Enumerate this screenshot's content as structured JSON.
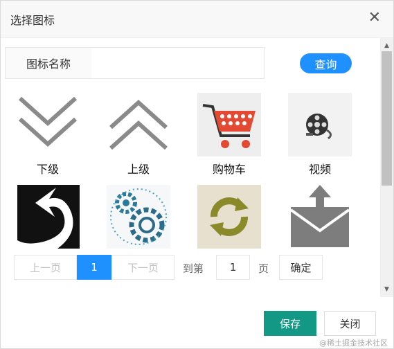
{
  "dialog": {
    "title": "选择图标",
    "close_symbol": "✕"
  },
  "search": {
    "label": "图标名称",
    "placeholder": "",
    "query_button": "查询"
  },
  "icons": [
    {
      "label": "下级",
      "icon": "double-chevron-down-icon"
    },
    {
      "label": "上级",
      "icon": "double-chevron-up-icon"
    },
    {
      "label": "购物车",
      "icon": "shopping-cart-icon"
    },
    {
      "label": "视频",
      "icon": "film-reel-icon"
    },
    {
      "label": "",
      "icon": "curved-arrow-icon"
    },
    {
      "label": "",
      "icon": "gears-icon"
    },
    {
      "label": "",
      "icon": "refresh-arrows-icon"
    },
    {
      "label": "",
      "icon": "mail-upload-icon"
    }
  ],
  "pagination": {
    "prev": "上一页",
    "current": "1",
    "next": "下一页",
    "goto_prefix": "到第",
    "goto_value": "1",
    "goto_suffix": "页",
    "confirm": "确定"
  },
  "footer": {
    "save": "保存",
    "close": "关闭"
  },
  "watermark": "@稀土掘金技术社区",
  "colors": {
    "primary_blue": "#1e90ff",
    "save_green": "#139885"
  }
}
